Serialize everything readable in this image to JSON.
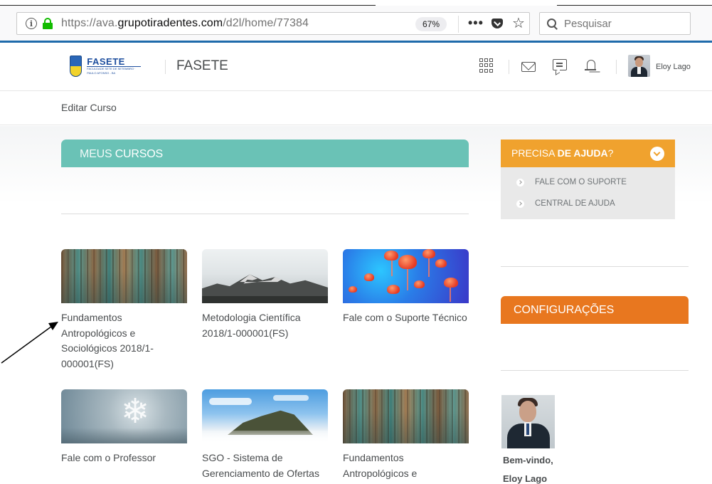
{
  "browser": {
    "url_prefix": "https://ava.",
    "url_domain": "grupotiradentes.com",
    "url_path": "/d2l/home/77384",
    "zoom": "67%",
    "search_placeholder": "Pesquisar",
    "overflow_glyph": "•••",
    "star_glyph": "☆",
    "info_glyph": "i"
  },
  "header": {
    "logo_name": "FASETE",
    "logo_subtitle": "FACULDADE SETE DE SETEMBRO · PAULO AFONSO - BA",
    "org_name": "FASETE",
    "user_name": "Eloy Lago"
  },
  "nav": {
    "edit_course": "Editar Curso"
  },
  "my_courses": {
    "title_light": "MEUS ",
    "title_bold": "CURSOS",
    "courses": [
      {
        "title": "Fundamentos Antropológicos e Sociológicos 2018/1-000001(FS)",
        "image": "wood-teal"
      },
      {
        "title": "Metodologia Científica 2018/1-000001(FS)",
        "image": "mountain"
      },
      {
        "title": "Fale com o Suporte Técnico",
        "image": "jellyfish"
      },
      {
        "title": "Fale com o Professor",
        "image": "snowflake"
      },
      {
        "title": "SGO - Sistema de Gerenciamento de Ofertas",
        "image": "island"
      },
      {
        "title": "Fundamentos Antropológicos e Sociológicos",
        "image": "wood-teal"
      }
    ]
  },
  "help": {
    "title_light": "PRECISA ",
    "title_bold": "DE AJUDA",
    "title_end": "?",
    "items": [
      "FALE COM O SUPORTE",
      "CENTRAL DE AJUDA"
    ]
  },
  "config": {
    "title": "CONFIGURAÇÕES"
  },
  "profile": {
    "welcome": "Bem-vindo,",
    "name": "Eloy Lago"
  },
  "colors": {
    "courses_header": "#6ac2b6",
    "help_header": "#f0a22e",
    "config_header": "#e8771f",
    "accent_blue": "#1f6bab"
  }
}
